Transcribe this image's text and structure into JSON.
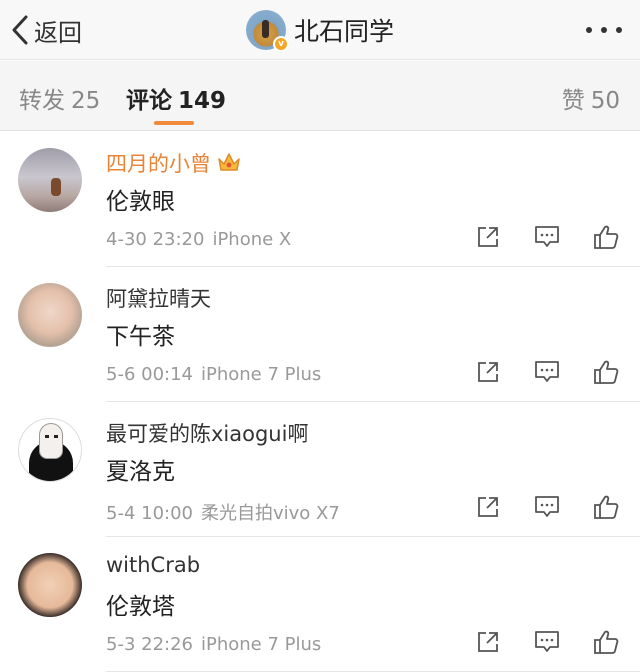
{
  "header": {
    "back_label": "返回",
    "title": "北石同学"
  },
  "tabs": [
    {
      "label": "转发",
      "count": "25"
    },
    {
      "label": "评论",
      "count": "149"
    },
    {
      "label": "赞",
      "count": "50"
    }
  ],
  "comments": [
    {
      "name": "四月的小曾",
      "text": "伦敦眼",
      "time": "4-30 23:20",
      "source": "iPhone X"
    },
    {
      "name": "阿黛拉晴天",
      "text": "下午茶",
      "time": "5-6 00:14",
      "source": "iPhone 7 Plus"
    },
    {
      "name": "最可爱的陈xiaogui啊",
      "text": "夏洛克",
      "time": "5-4 10:00",
      "source": "柔光自拍vivo X7"
    },
    {
      "name": "withCrab",
      "text": "伦敦塔",
      "time": "5-3 22:26",
      "source": "iPhone 7 Plus"
    }
  ],
  "colors": {
    "accent": "#f08a3c",
    "vip_name": "#e8853a",
    "meta_text": "#999999"
  },
  "icons": [
    "chevron-left-icon",
    "more-dots-icon",
    "verified-badge-icon",
    "crown-icon",
    "share-icon",
    "reply-icon",
    "like-icon"
  ]
}
